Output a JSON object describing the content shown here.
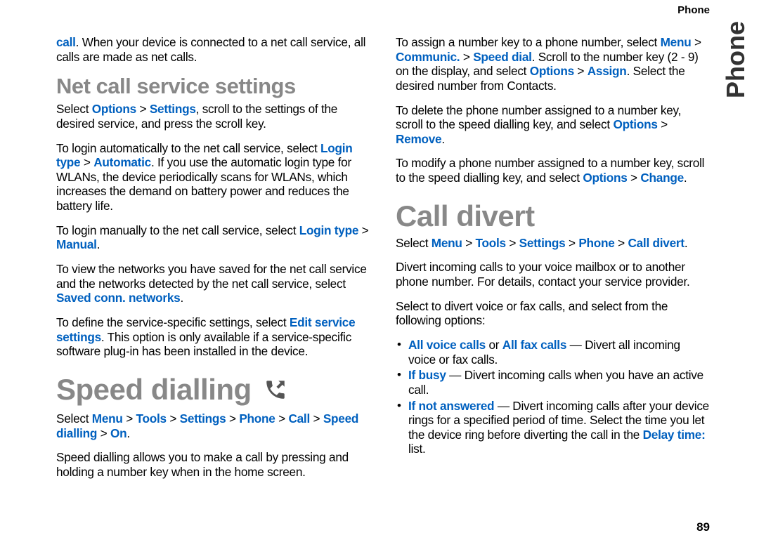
{
  "header": {
    "section": "Phone",
    "sideTab": "Phone",
    "pageNumber": "89"
  },
  "col1": {
    "p1_a": "call",
    "p1_b": ". When your device is connected to a net call service, all calls are made as net calls.",
    "h1": "Net call service settings",
    "p2_a": "Select ",
    "p2_b": "Options",
    "p2_c": " > ",
    "p2_d": "Settings",
    "p2_e": ", scroll to the settings of the desired service, and press the scroll key.",
    "p3_a": "To login automatically to the net call service, select ",
    "p3_b": "Login type",
    "p3_c": " > ",
    "p3_d": "Automatic",
    "p3_e": ". If you use the automatic login type for WLANs, the device periodically scans for WLANs, which increases the demand on battery power and reduces the battery life.",
    "p4_a": "To login manually to the net call service, select ",
    "p4_b": "Login type",
    "p4_c": " > ",
    "p4_d": "Manual",
    "p4_e": ".",
    "p5_a": "To view the networks you have saved for the net call service and the networks detected by the net call service, select ",
    "p5_b": "Saved conn. networks",
    "p5_c": ".",
    "p6_a": "To define the service-specific settings, select ",
    "p6_b": "Edit service settings",
    "p6_c": ". This option is only available if a service-specific software plug-in has been installed in the device.",
    "h2": "Speed dialling",
    "p7_a": "Select ",
    "p7_b": "Menu",
    "p7_c": " > ",
    "p7_d": "Tools",
    "p7_e": " > ",
    "p7_f": "Settings",
    "p7_g": " > ",
    "p7_h": "Phone",
    "p7_i": " > ",
    "p7_j": "Call",
    "p7_k": " > ",
    "p7_l": "Speed dialling",
    "p7_m": " > ",
    "p7_n": "On",
    "p7_o": ".",
    "p8": "Speed dialling allows you to make a call by pressing and holding a number key when in the home screen."
  },
  "col2": {
    "p1_a": "To assign a number key to a phone number, select ",
    "p1_b": "Menu",
    "p1_c": " > ",
    "p1_d": "Communic.",
    "p1_e": " > ",
    "p1_f": "Speed dial",
    "p1_g": ". Scroll to the number key (2 - 9) on the display, and select ",
    "p1_h": "Options",
    "p1_i": " > ",
    "p1_j": "Assign",
    "p1_k": ". Select the desired number from Contacts.",
    "p2_a": "To delete the phone number assigned to a number key, scroll to the speed dialling key, and select ",
    "p2_b": "Options",
    "p2_c": " > ",
    "p2_d": "Remove",
    "p2_e": ".",
    "p3_a": "To modify a phone number assigned to a number key, scroll to the speed dialling key, and select ",
    "p3_b": "Options",
    "p3_c": " > ",
    "p3_d": "Change",
    "p3_e": ".",
    "h1": "Call divert",
    "p4_a": "Select ",
    "p4_b": "Menu",
    "p4_c": " > ",
    "p4_d": "Tools",
    "p4_e": " > ",
    "p4_f": "Settings",
    "p4_g": " > ",
    "p4_h": "Phone",
    "p4_i": " > ",
    "p4_j": "Call divert",
    "p4_k": ".",
    "p5": "Divert incoming calls to your voice mailbox or to another phone number. For details, contact your service provider.",
    "p6": "Select to divert voice or fax calls, and select from the following options:",
    "li1_a": "All voice calls",
    "li1_b": " or ",
    "li1_c": "All fax calls",
    "li1_d": " — Divert all incoming voice or fax calls.",
    "li2_a": "If busy",
    "li2_b": "  — Divert incoming calls when you have an active call.",
    "li3_a": "If not answered",
    "li3_b": "  — Divert incoming calls after your device rings for a specified period of time. Select the time you let the device ring before diverting the call in the ",
    "li3_c": "Delay time:",
    "li3_d": " list."
  }
}
